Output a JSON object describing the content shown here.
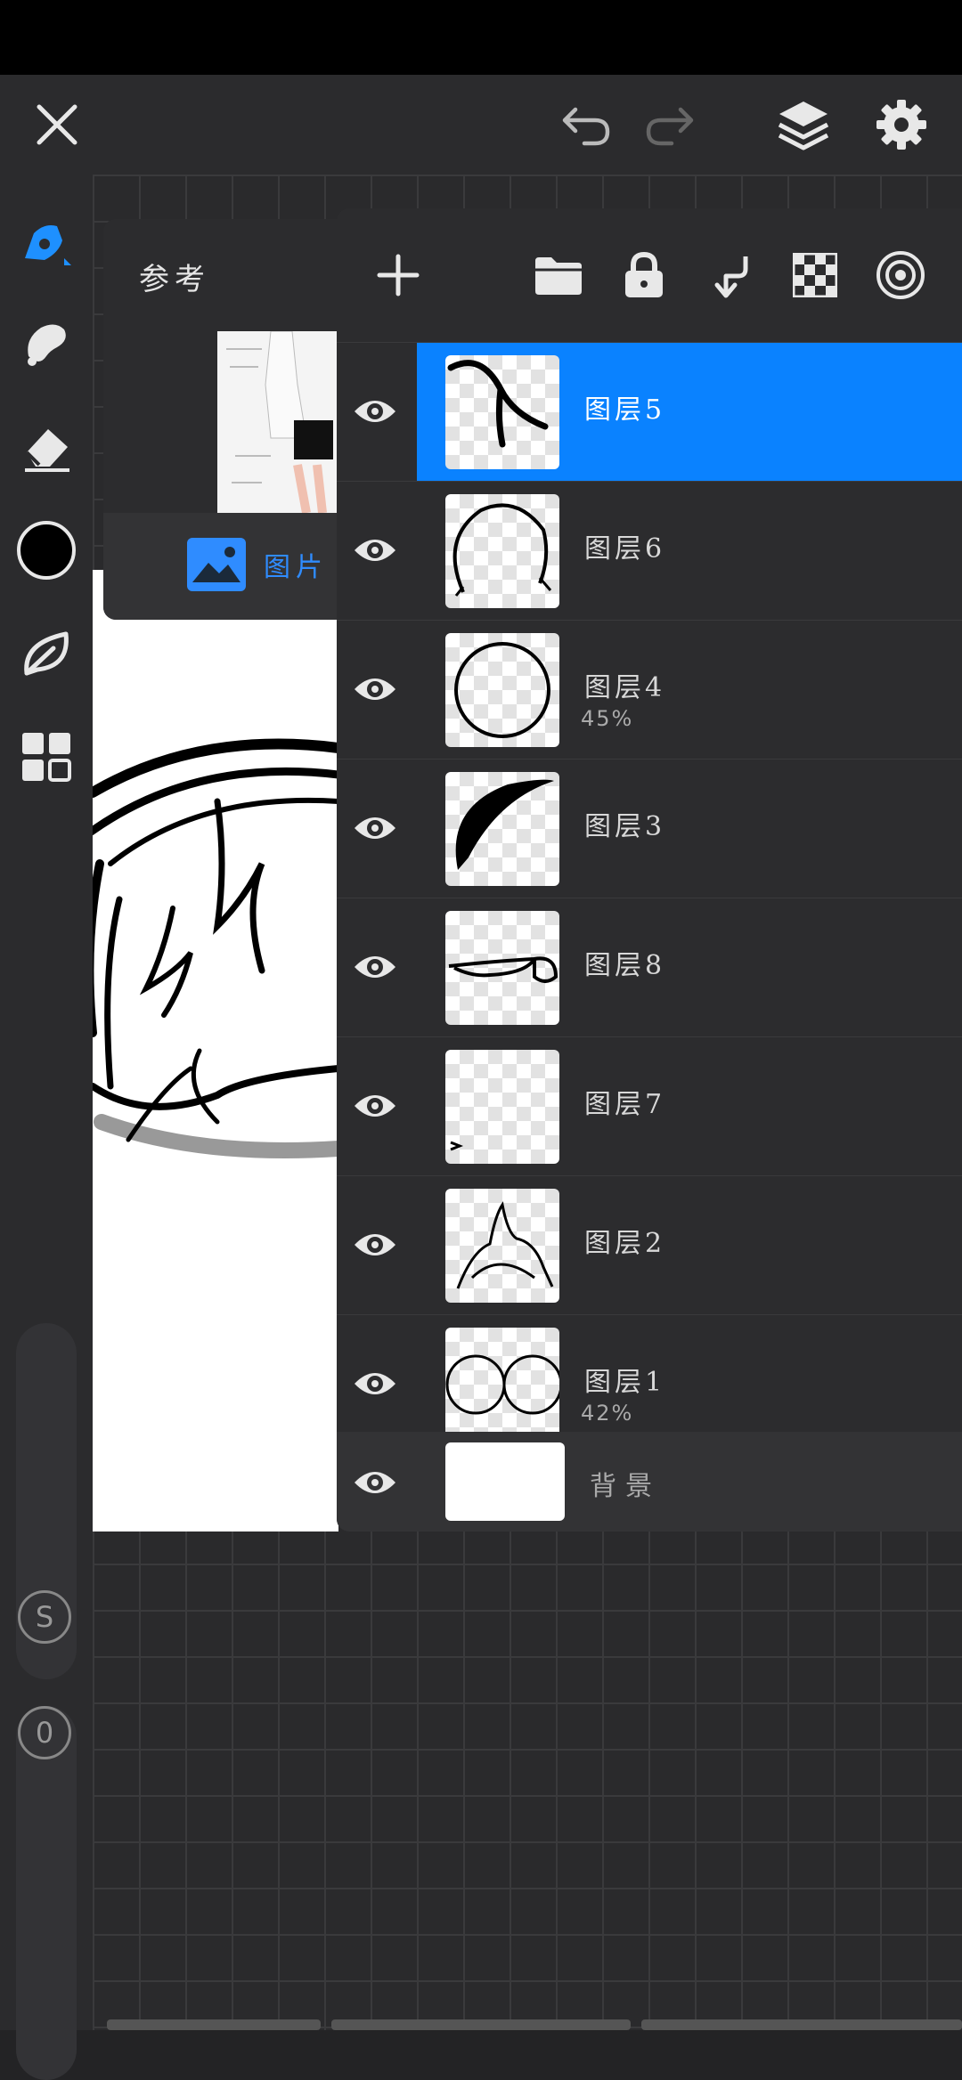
{
  "colors": {
    "accent": "#0a82ff",
    "panel": "#2c2c2e",
    "current_color": "#000000"
  },
  "topbar": {
    "icons": [
      "close-icon",
      "undo-icon",
      "redo-icon",
      "layers-icon",
      "settings-icon"
    ]
  },
  "left_toolbar": {
    "tools": [
      "brush-icon",
      "smudge-icon",
      "eraser-icon",
      "color-swatch",
      "leaf-icon",
      "grid-icon"
    ],
    "size_badge": "S",
    "opacity_badge": "0"
  },
  "reference": {
    "label": "参考",
    "tab_label": "图片"
  },
  "layers_toolbar": {
    "icons": [
      "add-icon",
      "folder-icon",
      "lock-icon",
      "merge-down-icon",
      "checkerboard-icon",
      "target-icon"
    ]
  },
  "layers": [
    {
      "name": "图层5",
      "opacity": "",
      "selected": true
    },
    {
      "name": "图层6",
      "opacity": "",
      "selected": false
    },
    {
      "name": "图层4",
      "opacity": "45%",
      "selected": false
    },
    {
      "name": "图层3",
      "opacity": "",
      "selected": false
    },
    {
      "name": "图层8",
      "opacity": "",
      "selected": false
    },
    {
      "name": "图层7",
      "opacity": "",
      "selected": false
    },
    {
      "name": "图层2",
      "opacity": "",
      "selected": false
    },
    {
      "name": "图层1",
      "opacity": "42%",
      "selected": false
    }
  ],
  "background_layer": {
    "name": "背景"
  }
}
